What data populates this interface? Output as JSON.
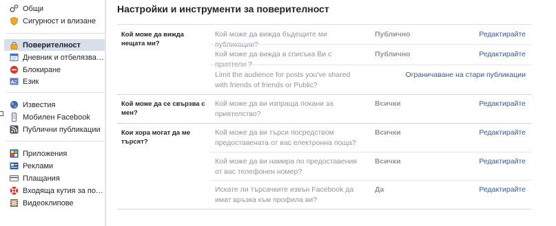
{
  "sidebar": {
    "items": [
      {
        "label": "Общи",
        "icon": "gears-icon"
      },
      {
        "label": "Сигурност и влизане",
        "icon": "shield-icon"
      },
      {
        "label": "Поверителност",
        "icon": "lock-icon"
      },
      {
        "label": "Дневник и отбелязвания",
        "icon": "timeline-icon"
      },
      {
        "label": "Блокиране",
        "icon": "block-icon"
      },
      {
        "label": "Език",
        "icon": "language-icon"
      },
      {
        "label": "Известия",
        "icon": "globe-icon"
      },
      {
        "label": "Мобилен Facebook",
        "icon": "mobile-icon"
      },
      {
        "label": "Публични публикации",
        "icon": "rss-icon"
      },
      {
        "label": "Приложения",
        "icon": "apps-icon"
      },
      {
        "label": "Реклами",
        "icon": "ads-icon"
      },
      {
        "label": "Плащания",
        "icon": "payments-icon"
      },
      {
        "label": "Входяща кутия за подд...",
        "icon": "support-icon"
      },
      {
        "label": "Видеоклипове",
        "icon": "video-icon"
      }
    ]
  },
  "main": {
    "title": "Настройки и инструменти за поверителност",
    "sections": [
      {
        "label": "Кой може да вижда нещата ми?",
        "rows": [
          {
            "question": "Кой може да вижда бъдещите ми публикации?",
            "value": "Публично",
            "action": "Редактирайте"
          },
          {
            "question": "Кой може да вижда в списъка Ви с приятели ?",
            "value": "Публично",
            "action": "Редактирайте"
          },
          {
            "question": "Limit the audience for posts you've shared with friends of friends or Public?",
            "value": "",
            "action": "Ограничаване на стари публикации"
          }
        ]
      },
      {
        "label": "Кой може да се свързва с мен?",
        "rows": [
          {
            "question": "Кой може да ви изпраща покани за приятелство?",
            "value": "Всички",
            "action": "Редактирайте"
          }
        ]
      },
      {
        "label": "Кои хора могат да ме търсят?",
        "rows": [
          {
            "question": "Кой може да ви търси посредством предоставената от вас електронна поща?",
            "value": "Всички",
            "action": "Редактирайте"
          },
          {
            "question": "Кой може да ви намира по предоставения от вас телефонен номер?",
            "value": "Всички",
            "action": "Редактирайте"
          },
          {
            "question": "Искате ли търсачките извън Facebook да имат връзка към профила ви?",
            "value": "Да",
            "action": "Редактирайте"
          }
        ]
      }
    ]
  },
  "colors": {
    "accent": "#365899",
    "active_bg": "#d8dfea",
    "page_bg": "#e9ebee"
  }
}
